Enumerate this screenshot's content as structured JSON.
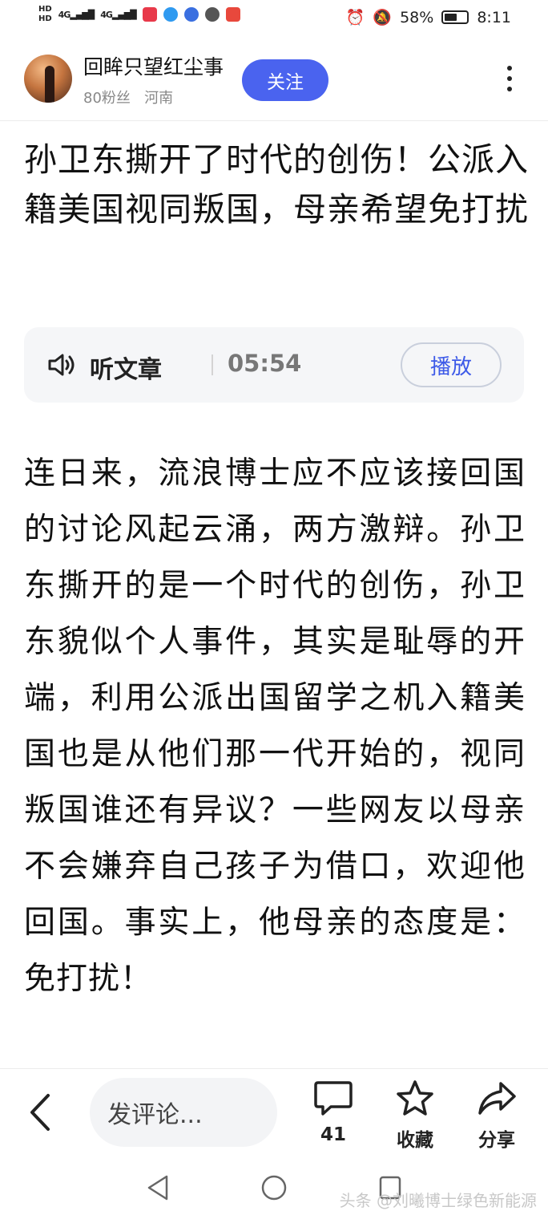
{
  "status_bar": {
    "hd1": "HD",
    "hd2": "HD",
    "sig1": "4G",
    "sig2": "4G",
    "battery_percent": "58%",
    "battery_level": 0.58,
    "time": "8:11"
  },
  "header": {
    "author_name": "回眸只望红尘事",
    "fans": "80粉丝",
    "location": "河南",
    "follow_label": "关注"
  },
  "article": {
    "title": "孙卫东撕开了时代的创伤！公派入籍美国视同叛国，母亲希望免打扰",
    "listen_label": "听文章",
    "duration": "05:54",
    "play_label": "播放",
    "body": "连日来，流浪博士应不应该接回国的讨论风起云涌，两方激辩。孙卫东撕开的是一个时代的创伤，孙卫东貌似个人事件，其实是耻辱的开端，利用公派出国留学之机入籍美国也是从他们那一代开始的，视同叛国谁还有异议？一些网友以母亲不会嫌弃自己孩子为借口，欢迎他回国。事实上，他母亲的态度是：免打扰！"
  },
  "bottom_bar": {
    "comment_placeholder": "发评论...",
    "comment_count": "41",
    "favorite_label": "收藏",
    "share_label": "分享"
  },
  "watermark": "头条 @刘曦博士绿色新能源",
  "colors": {
    "accent": "#4a63ef",
    "play_text": "#3d5ae8"
  }
}
